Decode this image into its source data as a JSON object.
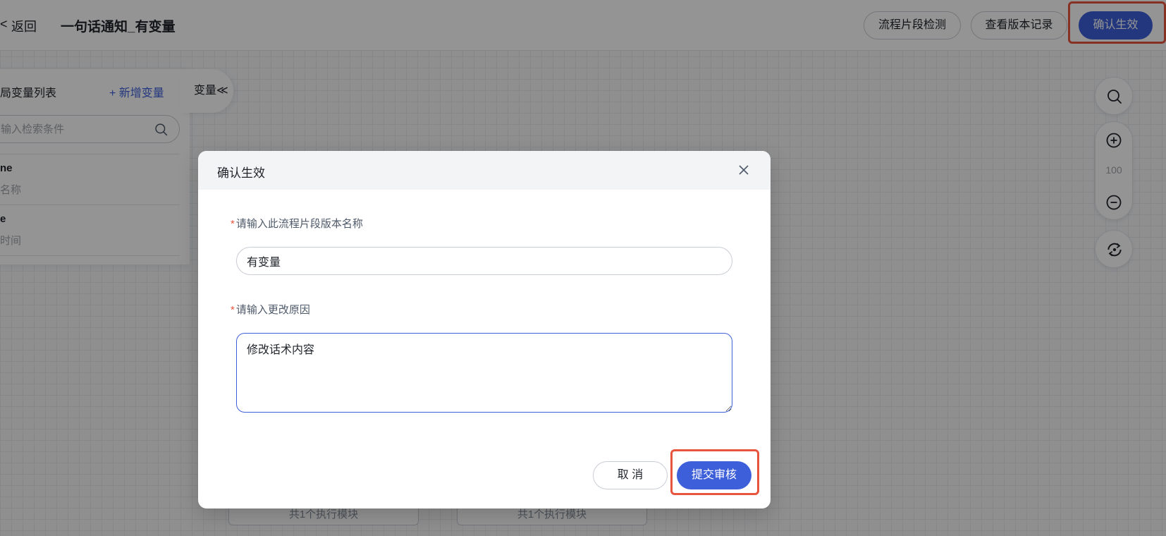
{
  "header": {
    "back_chevron": "<",
    "back_label": "返回",
    "title": "一句话通知_有变量",
    "buttons": {
      "check": "流程片段检测",
      "history": "查看版本记录",
      "confirm": "确认生效"
    }
  },
  "variable_panel": {
    "title": "局变量列表",
    "add_label": "+ 新增变量",
    "tab_label": "变量≪",
    "search_placeholder": "输入检索条件",
    "items": [
      {
        "name": "ne",
        "desc": "名称"
      },
      {
        "name": "e",
        "desc": "时间"
      }
    ]
  },
  "toolbar": {
    "zoom_level": "100"
  },
  "canvas": {
    "exec_labels": [
      "共1个执行模块",
      "共1个执行模块"
    ]
  },
  "modal": {
    "title": "确认生效",
    "name_field": {
      "required_mark": "*",
      "label": "请输入此流程片段版本名称",
      "value": "有变量"
    },
    "reason_field": {
      "required_mark": "*",
      "label": "请输入更改原因",
      "value": "修改话术内容"
    },
    "cancel_label": "取 消",
    "submit_label": "提交审核"
  },
  "colors": {
    "primary": "#3d5fd9",
    "highlight": "#e8553e",
    "required": "#e8553e"
  },
  "icons": [
    "search-icon",
    "zoom-in-icon",
    "zoom-out-icon",
    "recenter-icon",
    "close-icon",
    "back-chevron-icon"
  ]
}
